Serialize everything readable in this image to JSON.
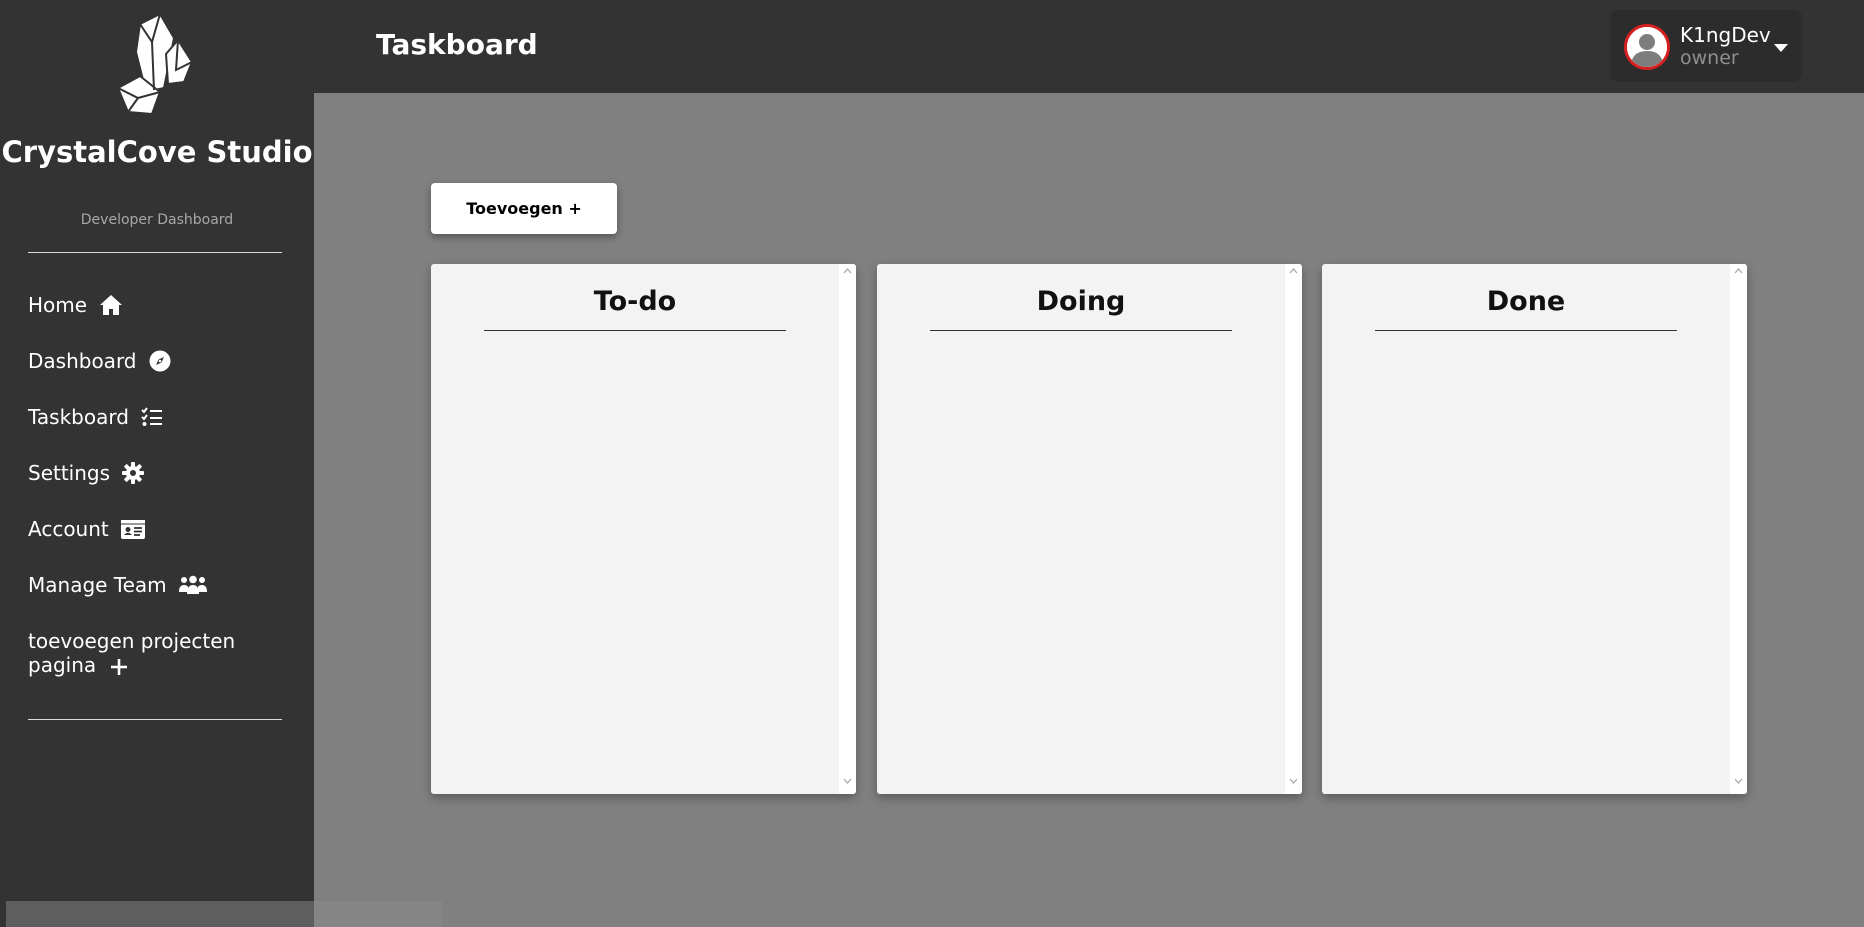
{
  "sidebar": {
    "brand": "CrystalCove Studio",
    "subtitle": "Developer Dashboard",
    "items": [
      {
        "label": "Home",
        "icon": "home-icon"
      },
      {
        "label": "Dashboard",
        "icon": "compass-icon"
      },
      {
        "label": "Taskboard",
        "icon": "task-list-icon"
      },
      {
        "label": "Settings",
        "icon": "gear-icon"
      },
      {
        "label": "Account",
        "icon": "id-card-icon"
      },
      {
        "label": "Manage Team",
        "icon": "users-icon"
      },
      {
        "label": "toevoegen projecten pagina",
        "icon": "plus-icon"
      }
    ]
  },
  "header": {
    "title": "Taskboard",
    "user": {
      "name": "K1ngDev",
      "role": "owner"
    }
  },
  "board": {
    "add_label": "Toevoegen +",
    "columns": [
      {
        "title": "To-do"
      },
      {
        "title": "Doing"
      },
      {
        "title": "Done"
      }
    ]
  },
  "colors": {
    "sidebar_bg": "#333333",
    "content_bg": "#808080",
    "column_bg": "#f3f3f3",
    "avatar_ring": "#d42020"
  }
}
